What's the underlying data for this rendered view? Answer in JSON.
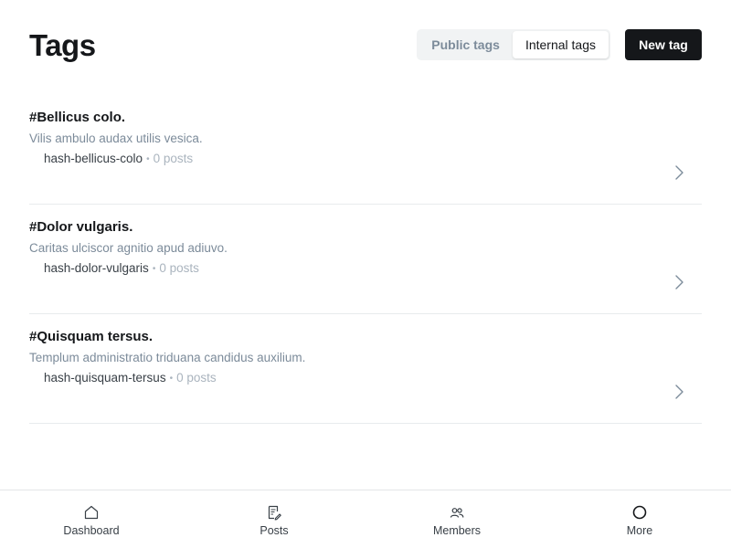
{
  "header": {
    "title": "Tags",
    "filters": [
      {
        "label": "Public tags",
        "active": false
      },
      {
        "label": "Internal tags",
        "active": true
      }
    ],
    "new_tag_label": "New tag"
  },
  "tags": [
    {
      "name": "#Bellicus colo.",
      "description": "Vilis ambulo audax utilis vesica.",
      "slug": "hash-bellicus-colo",
      "count": "0 posts"
    },
    {
      "name": "#Dolor vulgaris.",
      "description": "Caritas ulciscor agnitio apud adiuvo.",
      "slug": "hash-dolor-vulgaris",
      "count": "0 posts"
    },
    {
      "name": "#Quisquam tersus.",
      "description": "Templum administratio triduana candidus auxilium.",
      "slug": "hash-quisquam-tersus",
      "count": "0 posts"
    }
  ],
  "meta_separator": "•",
  "bottom_nav": [
    {
      "label": "Dashboard",
      "icon": "home-icon"
    },
    {
      "label": "Posts",
      "icon": "posts-icon"
    },
    {
      "label": "Members",
      "icon": "members-icon"
    },
    {
      "label": "More",
      "icon": "more-circle-icon"
    }
  ],
  "colors": {
    "primary_button": "#15171a",
    "muted_text": "#7c8b9a",
    "divider": "#e8ebed"
  }
}
